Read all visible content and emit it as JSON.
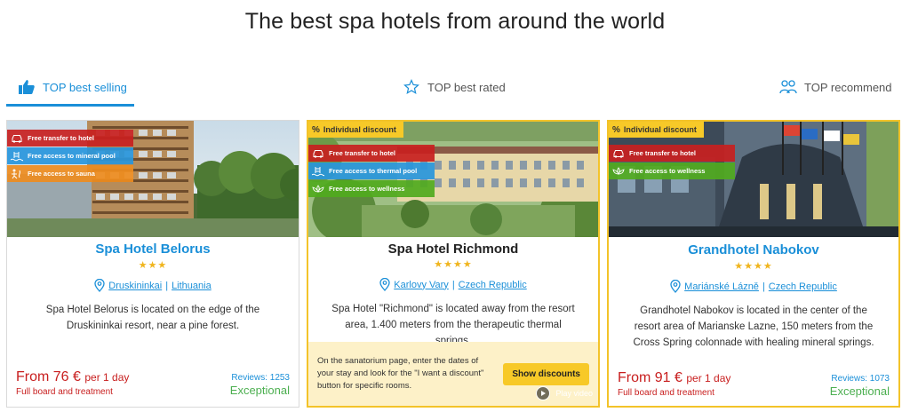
{
  "page": {
    "title": "The best spa hotels from around the world"
  },
  "tabs": [
    {
      "label": "TOP best selling",
      "icon": "thumbs-up-icon",
      "active": true
    },
    {
      "label": "TOP best rated",
      "icon": "star-outline-icon",
      "active": false
    },
    {
      "label": "TOP recommend",
      "icon": "people-icon",
      "active": false
    }
  ],
  "hotels": [
    {
      "name": "Spa Hotel Belorus",
      "stars": "★★★",
      "discount_badge": "",
      "ribbons": [
        {
          "label": "Free transfer to hotel",
          "icon": "car-icon",
          "color": "#c82020"
        },
        {
          "label": "Free access to mineral pool",
          "icon": "pool-icon",
          "color": "#2896dc"
        },
        {
          "label": "Free access to sauna",
          "icon": "sauna-icon",
          "color": "#ee8c1e"
        }
      ],
      "city": "Druskininkai",
      "country": "Lithuania",
      "description": "Spa Hotel Belorus is located on the edge of the Druskininkai resort, near a pine forest.",
      "price_prefix": "From",
      "price_amount": "76 €",
      "price_period": "per 1 day",
      "board": "Full board and treatment",
      "reviews": "Reviews: 1253",
      "rating_word": "Exceptional"
    },
    {
      "name": "Spa Hotel Richmond",
      "stars": "★★★★",
      "discount_badge": "Individual discount",
      "ribbons": [
        {
          "label": "Free transfer to hotel",
          "icon": "car-icon",
          "color": "#c82020"
        },
        {
          "label": "Free access to thermal pool",
          "icon": "pool-icon",
          "color": "#2896dc"
        },
        {
          "label": "Free access to wellness",
          "icon": "lotus-icon",
          "color": "#50aa1e"
        }
      ],
      "play_label": "Play video",
      "city": "Karlovy Vary",
      "country": "Czech Republic",
      "description": "Spa Hotel \"Richmond\" is located away from the resort area, 1.400 meters from the therapeutic thermal springs.",
      "promo_text": "On the sanatorium page, enter the dates of your stay and look for the \"I want a discount\" button for specific rooms.",
      "promo_button": "Show discounts"
    },
    {
      "name": "Grandhotel Nabokov",
      "stars": "★★★★",
      "discount_badge": "Individual discount",
      "ribbons": [
        {
          "label": "Free transfer to hotel",
          "icon": "car-icon",
          "color": "#c82020"
        },
        {
          "label": "Free access to wellness",
          "icon": "lotus-icon",
          "color": "#50aa1e"
        }
      ],
      "city": "Mariánské Lázně",
      "country": "Czech Republic",
      "description": "Grandhotel Nabokov is located in the center of the resort area of Marianske Lazne, 150 meters from the Cross Spring colonnade with healing mineral springs.",
      "price_prefix": "From",
      "price_amount": "91 €",
      "price_period": "per 1 day",
      "board": "Full board and treatment",
      "reviews": "Reviews: 1073",
      "rating_word": "Exceptional"
    }
  ],
  "colors": {
    "accent": "#1a8fd8",
    "price": "#c81e1e",
    "rating": "#4caf50",
    "featured_border": "#f3c32a"
  }
}
